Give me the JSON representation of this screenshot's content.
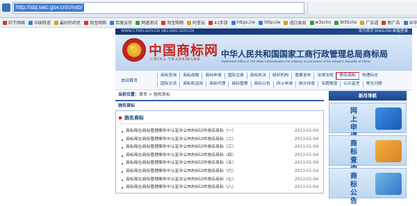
{
  "browser": {
    "url": "http://sbj.saic.gov.cn/cmsb/",
    "bookmarks": [
      "红牛网络",
      "中国铁道",
      "最好的农民",
      "淘宝网购",
      "百度云存",
      "网速测试",
      "淘宝购物",
      "阿里云",
      "41手游",
      "https://w",
      "http://w",
      "进口食品",
      "w3scho",
      "W3Scho",
      "广告语",
      "新广告",
      "中华人民"
    ]
  },
  "site": {
    "top_strip": {
      "left1": "WWW.CTMO.GOV.CN",
      "left2": "SBJ.SAIC.GOV.CN",
      "right": "设为首页 ENGLISH 邮箱登录"
    },
    "brand_cn": "中国商标网",
    "brand_en": "CHINA TRADEMARK",
    "org_cn": "中华人民共和国国家工商行政管理总局商标局",
    "org_en": "Trademark Office of The State Administration For Industry & Commerce of the People's Republic of China",
    "nav_home": "本站首页",
    "nav_row1": [
      "商标查询",
      "商标战略",
      "商标申请",
      "国际注册",
      "商标执法",
      "组织机构",
      "重要发布",
      "法律法规",
      "驰名商标",
      "地理标志"
    ],
    "nav_row2": [
      "国际交流",
      "商标权运用",
      "商标代理",
      "商标管理",
      "商标公告",
      "网上申请",
      "统计信息",
      "专题报道",
      "公众留言",
      "常见问题"
    ],
    "nav_highlight_index": 8
  },
  "breadcrumb": {
    "prefix": "当前位置：",
    "path": "首页 > 驰名商标"
  },
  "section": {
    "tab": "驰名商标",
    "box_title": "驰名商标"
  },
  "news": [
    {
      "title": "商标局在商标管理案件中认定并公布的602件驰名商标（一）",
      "date": "2013-01-04"
    },
    {
      "title": "商标局在商标管理案件中认定并公布的602件驰名商标（二）",
      "date": "2013-01-04"
    },
    {
      "title": "商标局在商标管理案件中认定并公布的602件驰名商标（三）",
      "date": "2013-01-04"
    },
    {
      "title": "商标局在商标管理案件中认定并公布的602件驰名商标（四）",
      "date": "2013-01-04"
    },
    {
      "title": "商标局在商标管理案件中认定并公布的602件驰名商标（五）",
      "date": "2013-01-04"
    },
    {
      "title": "商标局在商标管理案件中认定并公布的602件驰名商标（六）",
      "date": "2013-01-04"
    },
    {
      "title": "商标局在商标管理案件中认定并公布的602件驰名商标（七）",
      "date": "2013-01-04"
    },
    {
      "title": "商标局在商标管理案件中认定并公布的602件驰名商标（八）",
      "date": "2013-01-04"
    }
  ],
  "side": {
    "head": "新月导航",
    "tiles": [
      {
        "text": "网上申请"
      },
      {
        "text": "商标查询"
      },
      {
        "text": "商标公告"
      }
    ]
  },
  "colors": {
    "highlight": "#e21d1d",
    "brand_red": "#c8261b",
    "nav_blue": "#1d4683"
  }
}
